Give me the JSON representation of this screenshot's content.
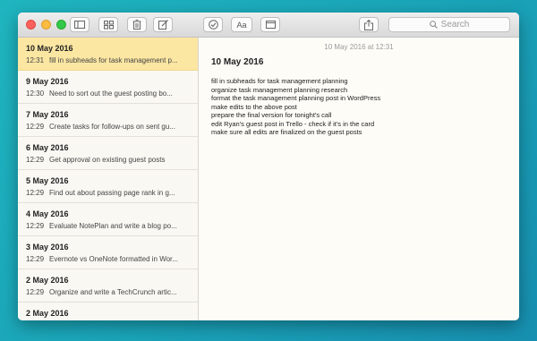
{
  "toolbar": {
    "search_placeholder": "Search",
    "icons": [
      "sidebar-toggle-icon",
      "attachments-grid-icon",
      "trash-icon",
      "compose-icon",
      "checklist-icon",
      "format-text-icon",
      "table-icon",
      "share-icon",
      "search-icon"
    ],
    "format_label": "Aa"
  },
  "notes": [
    {
      "date": "10 May 2016",
      "time": "12:31",
      "snippet": "fill in subheads for task management p..."
    },
    {
      "date": "9 May 2016",
      "time": "12:30",
      "snippet": "Need to sort out the guest posting bo..."
    },
    {
      "date": "7 May 2016",
      "time": "12:29",
      "snippet": "Create tasks for follow-ups on sent gu..."
    },
    {
      "date": "6 May 2016",
      "time": "12:29",
      "snippet": "Get approval on existing guest posts"
    },
    {
      "date": "5 May 2016",
      "time": "12:29",
      "snippet": "Find out about passing page rank in g..."
    },
    {
      "date": "4 May 2016",
      "time": "12:29",
      "snippet": "Evaluate NotePlan and write a blog po..."
    },
    {
      "date": "3 May 2016",
      "time": "12:29",
      "snippet": "Evernote vs OneNote formatted in Wor..."
    },
    {
      "date": "2 May 2016",
      "time": "12:29",
      "snippet": "Organize and write a TechCrunch artic..."
    },
    {
      "date": "2 May 2016",
      "time": "",
      "snippet": ""
    }
  ],
  "editor": {
    "timestamp": "10 May 2016 at 12:31",
    "title": "10 May 2016",
    "lines": [
      "fill in subheads for task management planning",
      "organize task management planning research",
      "format the task management planning post in WordPress",
      "make edits to the above post",
      "prepare the final version for tonight's call",
      "edit Ryan's guest post in Trello - check if it's in the card",
      "make sure all edits are finalized on the guest posts"
    ]
  },
  "colors": {
    "selected_row": "#fbe6a2",
    "background_accent": "#1aa3b8"
  }
}
